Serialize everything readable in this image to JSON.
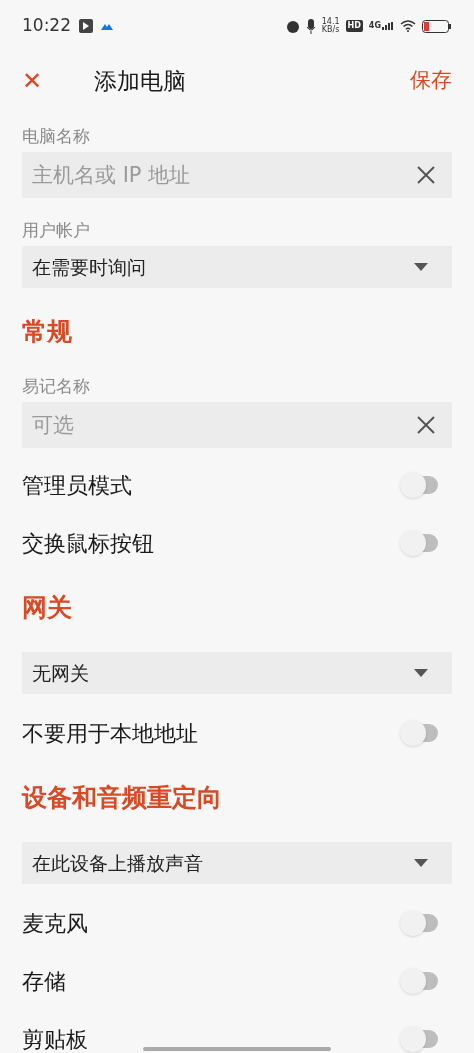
{
  "status_bar": {
    "time": "10:22",
    "speed": "14.1",
    "speed_unit": "KB/s",
    "hd": "HD",
    "network": "4G"
  },
  "header": {
    "close": "✕",
    "title": "添加电脑",
    "save": "保存"
  },
  "items": [
    {
      "kind": "field",
      "label": "电脑名称",
      "placeholder": "主机名或 IP 地址"
    },
    {
      "kind": "dropdown",
      "label": "用户帐户",
      "value": "在需要时询问"
    },
    {
      "kind": "heading",
      "text": "常规"
    },
    {
      "kind": "field",
      "label": "易记名称",
      "placeholder": "可选"
    },
    {
      "kind": "toggle",
      "label": "管理员模式",
      "on": false
    },
    {
      "kind": "toggle",
      "label": "交换鼠标按钮",
      "on": false
    },
    {
      "kind": "heading",
      "text": "网关"
    },
    {
      "kind": "dropdown",
      "value": "无网关"
    },
    {
      "kind": "toggle",
      "label": "不要用于本地地址",
      "on": false
    },
    {
      "kind": "heading",
      "text": "设备和音频重定向"
    },
    {
      "kind": "dropdown",
      "value": "在此设备上播放声音"
    },
    {
      "kind": "toggle",
      "label": "麦克风",
      "on": false
    },
    {
      "kind": "toggle",
      "label": "存储",
      "on": false
    },
    {
      "kind": "toggle",
      "label": "剪贴板",
      "on": false
    }
  ]
}
